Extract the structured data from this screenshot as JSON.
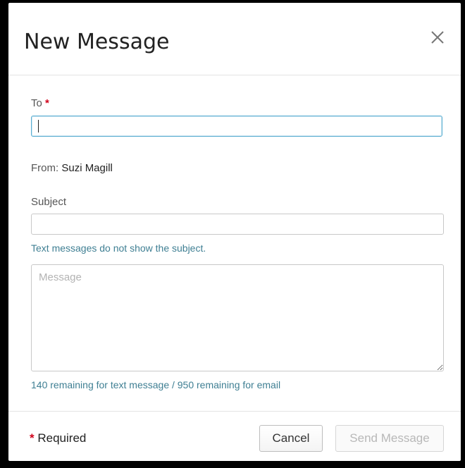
{
  "dialog": {
    "title": "New Message",
    "close_icon": "close-icon"
  },
  "to": {
    "label": "To",
    "required_mark": "*",
    "value": ""
  },
  "from": {
    "label": "From:",
    "name": "Suzi Magill"
  },
  "subject": {
    "label": "Subject",
    "value": "",
    "hint": "Text messages do not show the subject."
  },
  "message": {
    "placeholder": "Message",
    "value": "",
    "counter": "140 remaining for text message / 950 remaining for email"
  },
  "footer": {
    "required_mark": "*",
    "required_label": "Required",
    "cancel_label": "Cancel",
    "send_label": "Send Message"
  },
  "colors": {
    "required": "#d0021b",
    "focus_border": "#5aaed1",
    "hint_text": "#3f7f93"
  }
}
